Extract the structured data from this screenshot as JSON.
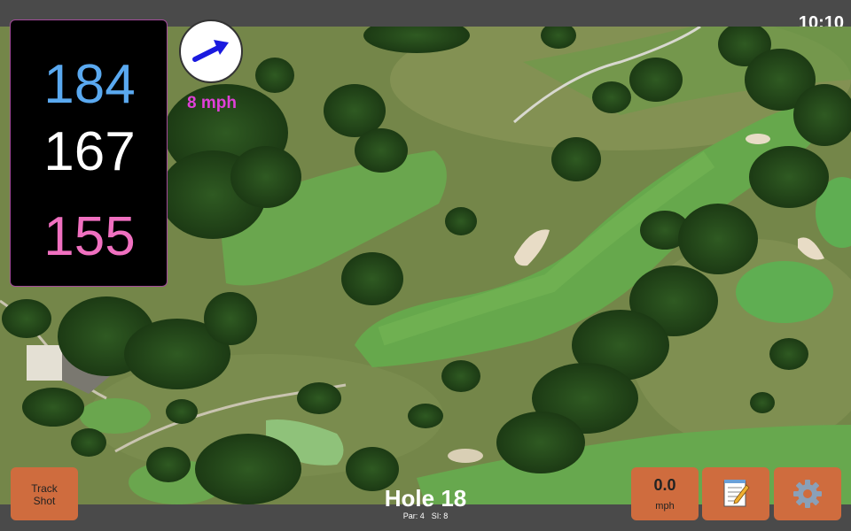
{
  "status_bar": {
    "time": "10:10"
  },
  "distances": {
    "back": "184",
    "middle": "167",
    "front": "155"
  },
  "wind": {
    "speed": "8 mph",
    "icon": "wind-direction-arrow-icon"
  },
  "hole": {
    "title": "Hole 18",
    "par": "Par: 4",
    "stroke_index": "SI: 8"
  },
  "buttons": {
    "track_shot": {
      "line1": "Track",
      "line2": "Shot"
    },
    "speed": {
      "value": "0.0",
      "unit": "mph"
    },
    "notes": {
      "icon": "notepad-icon"
    },
    "settings": {
      "icon": "gear-icon"
    }
  },
  "colors": {
    "back_distance": "#5aa9f0",
    "middle_distance": "#ffffff",
    "front_distance": "#f070c0",
    "wind_text": "#e040d8",
    "button": "#cf6c3e",
    "bar": "#4a4a4a"
  },
  "map": {
    "type": "satellite-aerial-golf-course"
  }
}
